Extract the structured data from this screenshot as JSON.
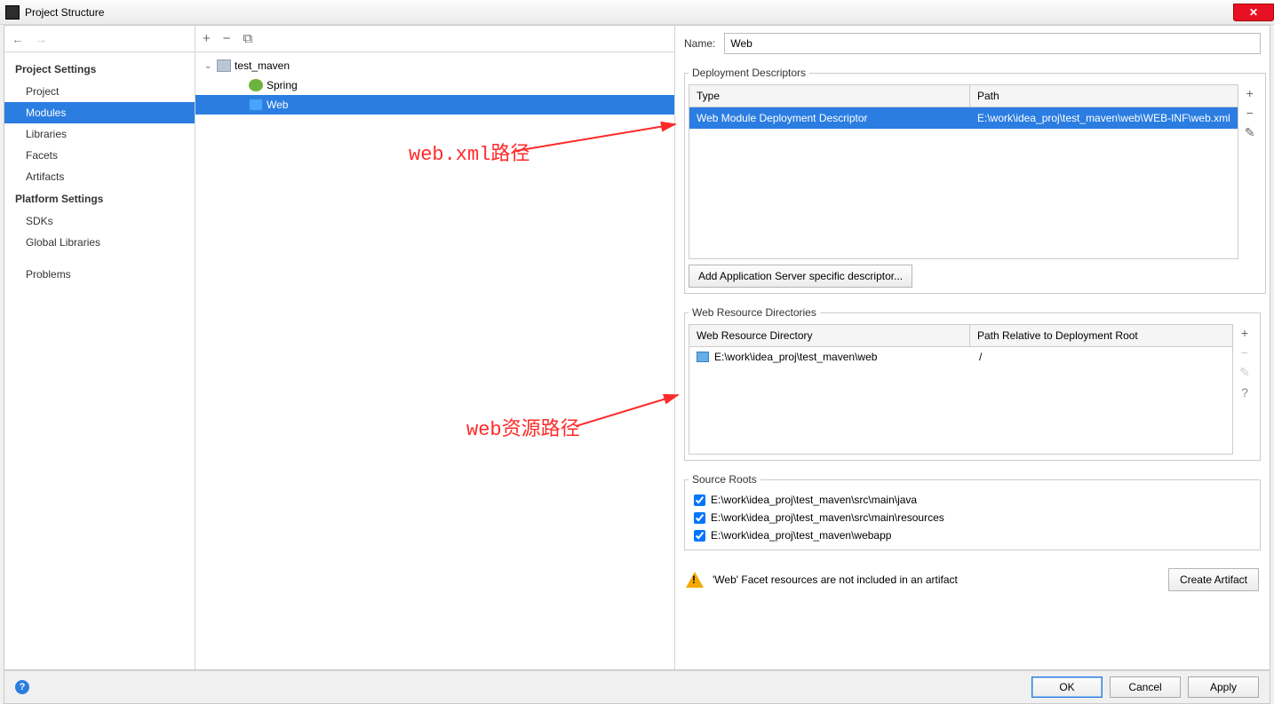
{
  "window": {
    "title": "Project Structure"
  },
  "sidebar": {
    "section1": "Project Settings",
    "items1": [
      "Project",
      "Modules",
      "Libraries",
      "Facets",
      "Artifacts"
    ],
    "selected1": 1,
    "section2": "Platform Settings",
    "items2": [
      "SDKs",
      "Global Libraries"
    ],
    "section3": "",
    "items3": [
      "Problems"
    ]
  },
  "tree": {
    "root": "test_maven",
    "children": [
      {
        "label": "Spring",
        "icon": "spring"
      },
      {
        "label": "Web",
        "icon": "web"
      }
    ],
    "selected": 1
  },
  "details": {
    "name_label": "Name:",
    "name_value": "Web",
    "dd": {
      "legend": "Deployment Descriptors",
      "col_type": "Type",
      "col_path": "Path",
      "row_type": "Web Module Deployment Descriptor",
      "row_path": "E:\\work\\idea_proj\\test_maven\\web\\WEB-INF\\web.xml",
      "add_btn": "Add Application Server specific descriptor..."
    },
    "wrd": {
      "legend": "Web Resource Directories",
      "col_dir": "Web Resource Directory",
      "col_rel": "Path Relative to Deployment Root",
      "row_dir": "E:\\work\\idea_proj\\test_maven\\web",
      "row_rel": "/"
    },
    "src": {
      "legend": "Source Roots",
      "items": [
        "E:\\work\\idea_proj\\test_maven\\src\\main\\java",
        "E:\\work\\idea_proj\\test_maven\\src\\main\\resources",
        "E:\\work\\idea_proj\\test_maven\\webapp"
      ]
    },
    "warn": "'Web' Facet resources are not included in an artifact",
    "create_artifact": "Create Artifact"
  },
  "buttons": {
    "ok": "OK",
    "cancel": "Cancel",
    "apply": "Apply"
  },
  "annotations": {
    "a1": "web.xml路径",
    "a2": "web资源路径"
  }
}
